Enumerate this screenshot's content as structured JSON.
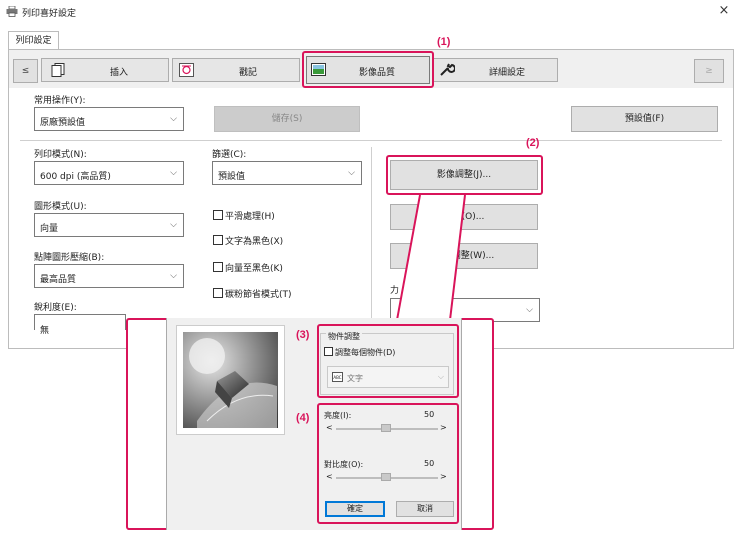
{
  "window": {
    "title": "列印喜好設定",
    "close_glyph": "×"
  },
  "tabs": [
    {
      "label": "列印設定"
    }
  ],
  "toolbar": {
    "nav_prev": "≤",
    "nav_next": "≥",
    "items": [
      {
        "label": "插入",
        "icon": "insert-pages-icon"
      },
      {
        "label": "戳記",
        "icon": "stamp-icon"
      },
      {
        "label": "影像品質",
        "icon": "image-quality-icon"
      },
      {
        "label": "詳細設定",
        "icon": "wrench-icon"
      }
    ]
  },
  "common_ops": {
    "label": "常用操作(Y):",
    "value": "原廠預設值",
    "save_label": "儲存(S)",
    "defaults_label": "預設值(F)"
  },
  "print_mode": {
    "label": "列印模式(N):",
    "value": "600 dpi (高品質)"
  },
  "screening": {
    "label": "篩選(C):",
    "value": "預設值"
  },
  "graphics_mode": {
    "label": "圖形模式(U):",
    "value": "向量"
  },
  "raster_compression": {
    "label": "點陣圖形壓縮(B):",
    "value": "最高品質"
  },
  "sharpness": {
    "label": "銳利度(E):",
    "value": "無"
  },
  "checkboxes": [
    {
      "label": "平滑處理(H)"
    },
    {
      "label": "文字為黑色(X)"
    },
    {
      "label": "向量至黑色(K)"
    },
    {
      "label": "碳粉節省模式(T)"
    }
  ],
  "right_buttons": {
    "image_adjust": "影像調整(J)...",
    "font": "字型(O)...",
    "line_width": "線寬調整(W)..."
  },
  "partial_label": "力",
  "callouts": [
    "(1)",
    "(2)",
    "(3)",
    "(4)"
  ],
  "popup": {
    "object_adjust_group": "物件調整",
    "adjust_all_objects": "調整每個物件(D)",
    "object_select": {
      "badge": "ABC",
      "value": "文字"
    },
    "brightness": {
      "label": "亮度(I):",
      "value": "50"
    },
    "contrast": {
      "label": "對比度(O):",
      "value": "50"
    },
    "arrow_left": "<",
    "arrow_right": ">",
    "ok_label": "確定",
    "cancel_label": "取消"
  },
  "colors": {
    "accent": "#d9145a",
    "selected_tab": "#e6e6e6"
  }
}
